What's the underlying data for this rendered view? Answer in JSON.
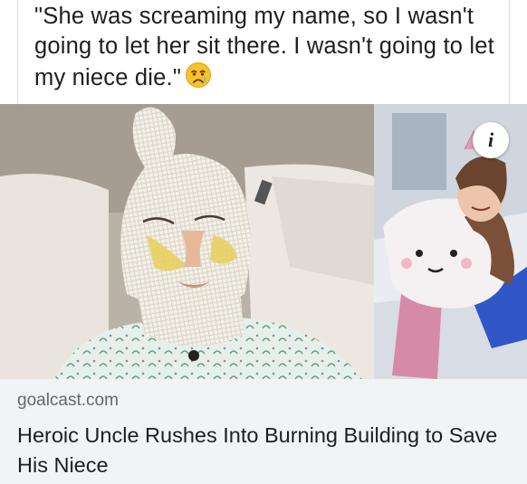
{
  "post": {
    "text": "\"She was screaming my name, so I wasn't going to let her sit there. I wasn't going to let my niece die.\"",
    "emoji": "crying-face-emoji"
  },
  "link_preview": {
    "domain": "goalcast.com",
    "headline": "Heroic Uncle Rushes Into Burning Building to Save His Niece",
    "info_label": "i",
    "images": [
      "bandaged-man-hospital-photo",
      "smiling-girl-photo"
    ]
  },
  "colors": {
    "text": "#1c1e21",
    "secondary_text": "#65676b",
    "card_background": "#f2f3f5"
  }
}
